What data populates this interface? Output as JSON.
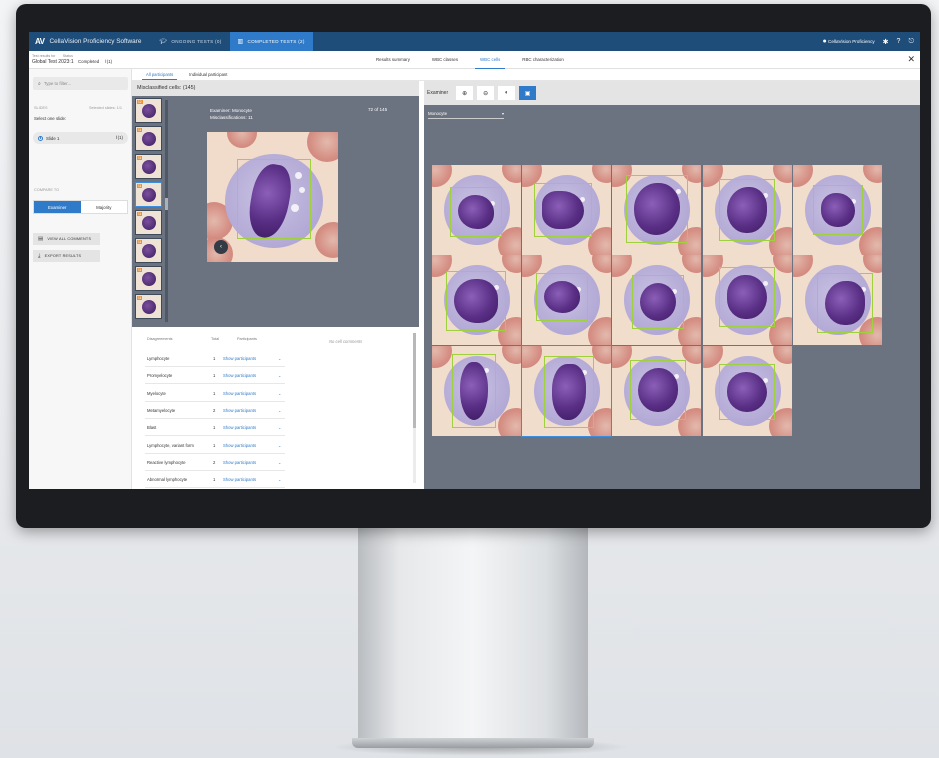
{
  "app": {
    "logo": "AV",
    "name": "CellaVision Proficiency Software",
    "tabs": [
      {
        "label": "ONGOING TESTS (0)",
        "icon": "graduation-cap-icon",
        "active": false
      },
      {
        "label": "COMPLETED TESTS (2)",
        "icon": "bar-chart-icon",
        "active": true
      }
    ],
    "user": "CellaVision Proficiency"
  },
  "test": {
    "results_for_label": "Test results for",
    "name": "Global Test 2023:1",
    "status_label": "Status",
    "status": "Completed",
    "attachments": "(1)"
  },
  "nav_tabs": [
    "Results summary",
    "WBC classes",
    "WBC cells",
    "RBC characterization"
  ],
  "active_nav_tab": "WBC cells",
  "sidebar": {
    "search_placeholder": "Type to filter...",
    "slides_label": "SLIDES",
    "selected_slides": "Selected slides: 1/1",
    "select_one": "Select one slide:",
    "slide_name": "Slide 1",
    "slide_attachments": "(1)",
    "compare_label": "COMPARE TO",
    "compare_options": [
      "Examiner",
      "Majority"
    ],
    "compare_selected": "Examiner",
    "view_comments": "VIEW ALL COMMENTS",
    "export_results": "EXPORT RESULTS"
  },
  "sub_tabs": [
    "All participants",
    "Individual participant"
  ],
  "left_panel": {
    "title": "Misclassified cells: (145)",
    "examiner_line": "Examiner: Monocyte",
    "misclass_line": "Misclassifications: 11",
    "count": "72 of 145",
    "thumb_numbers": [
      "12",
      "11",
      "11",
      "11",
      "11",
      "11",
      "11",
      "11"
    ]
  },
  "right_panel": {
    "examiner_label": "Examiner",
    "dropdown_value": "Monocyte"
  },
  "table": {
    "headers": [
      "Disagreements",
      "Total",
      "Participants"
    ],
    "no_comments": "No cell comments",
    "rows": [
      {
        "name": "Lymphocyte",
        "total": "1",
        "link": "Show participants"
      },
      {
        "name": "Promyelocyte",
        "total": "1",
        "link": "Show participants"
      },
      {
        "name": "Myelocyte",
        "total": "1",
        "link": "Show participants"
      },
      {
        "name": "Metamyelocyte",
        "total": "2",
        "link": "Show participants"
      },
      {
        "name": "Blast",
        "total": "1",
        "link": "Show participants"
      },
      {
        "name": "Lymphocyte, variant form",
        "total": "1",
        "link": "Show participants"
      },
      {
        "name": "Reactive lymphocyte",
        "total": "2",
        "link": "Show participants"
      },
      {
        "name": "Abnormal lymphocyte",
        "total": "1",
        "link": "Show participants"
      }
    ]
  },
  "colors": {
    "topbar": "#1e4d7a",
    "accent": "#2f7bc9",
    "panel_bg": "#6b7280",
    "frame_green": "#9ed13b"
  }
}
